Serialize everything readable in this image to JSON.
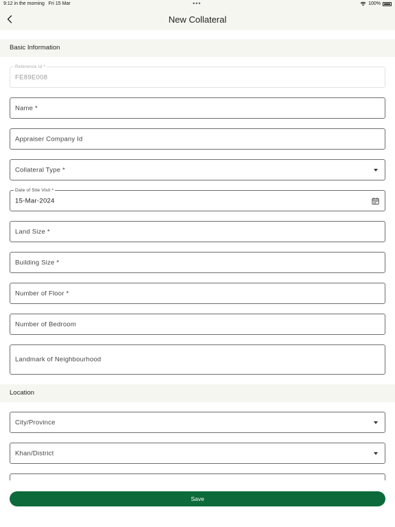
{
  "status_bar": {
    "time": "9:12 in the morning",
    "date": "Fri 15 Mar",
    "dots": "•••",
    "battery": "100%"
  },
  "nav": {
    "title": "New Collateral"
  },
  "sections": {
    "basic_information": "Basic Information",
    "location": "Location"
  },
  "fields": {
    "reference_id": {
      "label": "Reference Id *",
      "value": "FE89E008"
    },
    "name": {
      "label": "Name *"
    },
    "appraiser_company_id": {
      "label": "Appraiser Company Id"
    },
    "collateral_type": {
      "label": "Collateral Type *"
    },
    "date_of_site_visit": {
      "label": "Date of Site Visit *",
      "value": "15-Mar-2024"
    },
    "land_size": {
      "label": "Land Size *"
    },
    "building_size": {
      "label": "Building Size *"
    },
    "number_of_floor": {
      "label": "Number of Floor *"
    },
    "number_of_bedroom": {
      "label": "Number of Bedroom"
    },
    "landmark": {
      "label": "Landmark of Neighbourhood"
    },
    "city_province": {
      "label": "City/Province"
    },
    "khan_district": {
      "label": "Khan/District"
    }
  },
  "actions": {
    "save": "Save"
  },
  "colors": {
    "primary": "#0d6a3a",
    "header_bg": "#f6f6f1",
    "field_border": "#6e6e6e"
  }
}
